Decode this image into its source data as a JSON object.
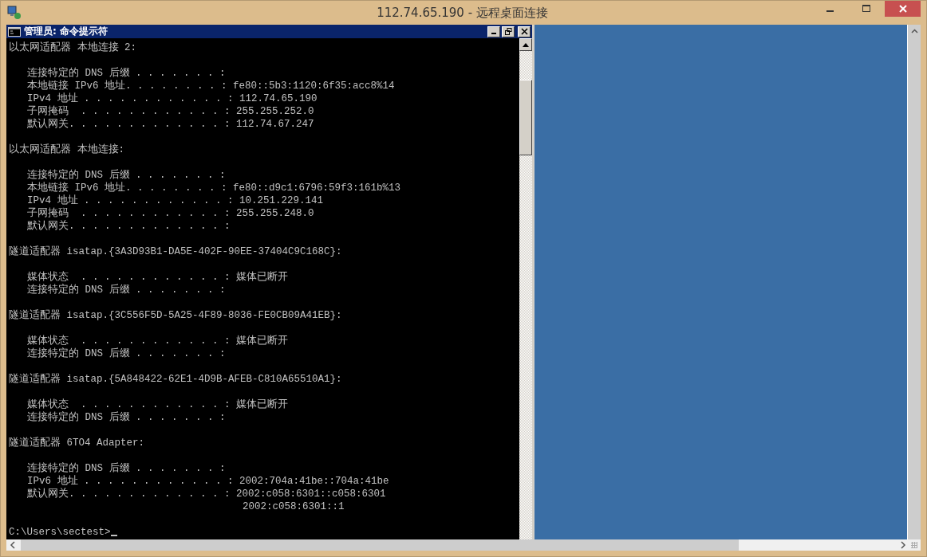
{
  "window": {
    "title": "112.74.65.190 - 远程桌面连接"
  },
  "cmd": {
    "title": "管理员: 命令提示符",
    "blocks": [
      {
        "kind": "header",
        "lines": [
          "以太网适配器 本地连接 2:"
        ]
      },
      {
        "kind": "entries",
        "lines": [
          "连接特定的 DNS 后缀 . . . . . . . :",
          "本地链接 IPv6 地址. . . . . . . . : fe80::5b3:1120:6f35:acc8%14",
          "IPv4 地址 . . . . . . . . . . . . : 112.74.65.190",
          "子网掩码  . . . . . . . . . . . . : 255.255.252.0",
          "默认网关. . . . . . . . . . . . . : 112.74.67.247"
        ]
      },
      {
        "kind": "header",
        "lines": [
          "以太网适配器 本地连接:"
        ]
      },
      {
        "kind": "entries",
        "lines": [
          "连接特定的 DNS 后缀 . . . . . . . :",
          "本地链接 IPv6 地址. . . . . . . . : fe80::d9c1:6796:59f3:161b%13",
          "IPv4 地址 . . . . . . . . . . . . : 10.251.229.141",
          "子网掩码  . . . . . . . . . . . . : 255.255.248.0",
          "默认网关. . . . . . . . . . . . . :"
        ]
      },
      {
        "kind": "header",
        "lines": [
          "隧道适配器 isatap.{3A3D93B1-DA5E-402F-90EE-37404C9C168C}:"
        ]
      },
      {
        "kind": "entries",
        "lines": [
          "媒体状态  . . . . . . . . . . . . : 媒体已断开",
          "连接特定的 DNS 后缀 . . . . . . . :"
        ]
      },
      {
        "kind": "header",
        "lines": [
          "隧道适配器 isatap.{3C556F5D-5A25-4F89-8036-FE0CB09A41EB}:"
        ]
      },
      {
        "kind": "entries",
        "lines": [
          "媒体状态  . . . . . . . . . . . . : 媒体已断开",
          "连接特定的 DNS 后缀 . . . . . . . :"
        ]
      },
      {
        "kind": "header",
        "lines": [
          "隧道适配器 isatap.{5A848422-62E1-4D9B-AFEB-C810A65510A1}:"
        ]
      },
      {
        "kind": "entries",
        "lines": [
          "媒体状态  . . . . . . . . . . . . : 媒体已断开",
          "连接特定的 DNS 后缀 . . . . . . . :"
        ]
      },
      {
        "kind": "header",
        "lines": [
          "隧道适配器 6TO4 Adapter:"
        ]
      },
      {
        "kind": "entries",
        "lines": [
          "连接特定的 DNS 后缀 . . . . . . . :",
          "IPv6 地址 . . . . . . . . . . . . : 2002:704a:41be::704a:41be",
          "默认网关. . . . . . . . . . . . . : 2002:c058:6301::c058:6301",
          "                                    2002:c058:6301::1"
        ]
      },
      {
        "kind": "prompt",
        "lines": [
          "C:\\Users\\sectest>"
        ]
      }
    ]
  }
}
